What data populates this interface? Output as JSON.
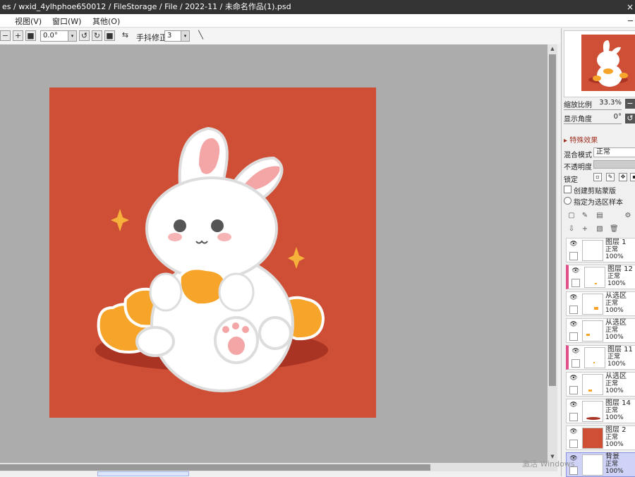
{
  "titlebar": {
    "title": "es / wxid_4ylhphoe650012 / FileStorage / File / 2022-11 / 未命名作品(1).psd",
    "close_glyph": "×"
  },
  "menubar": {
    "items": [
      "视图(V)",
      "窗口(W)",
      "其他(O)"
    ]
  },
  "toolbar": {
    "minus_glyph": "−",
    "plus_glyph": "+",
    "square_glyph": "■",
    "rotation_value": "0.0°",
    "rotate_ccw_glyph": "↺",
    "rotate_cw_glyph": "↻",
    "reset_glyph": "■",
    "flip_glyph": "⇆",
    "stabilizer_label": "手抖修正",
    "stabilizer_value": "3",
    "pen_glyph": "╲",
    "dropdown_glyph": "▾"
  },
  "navigator": {
    "zoom_label": "缩放比例",
    "zoom_value": "33.3%",
    "angle_label": "显示角度",
    "angle_value": "0°",
    "zoom_btn_glyph": "−",
    "angle_btn_glyph": "↺"
  },
  "properties": {
    "fx_label": "▸ 特殊效果",
    "blend_label": "混合模式",
    "blend_value": "正常",
    "opacity_label": "不透明度",
    "lock_label": "锁定",
    "clip_label": "创建剪贴蒙版",
    "select_source_label": "指定为选区样本"
  },
  "layers": [
    {
      "name": "图层 1",
      "mode": "正常",
      "opacity": "100%",
      "marked": false,
      "selected": false
    },
    {
      "name": "图层 12",
      "mode": "正常",
      "opacity": "100%",
      "marked": true,
      "selected": false
    },
    {
      "name": "从选区",
      "mode": "正常",
      "opacity": "100%",
      "marked": false,
      "selected": false
    },
    {
      "name": "从选区",
      "mode": "正常",
      "opacity": "100%",
      "marked": false,
      "selected": false
    },
    {
      "name": "图层 11",
      "mode": "正常",
      "opacity": "100%",
      "marked": true,
      "selected": false
    },
    {
      "name": "从选区",
      "mode": "正常",
      "opacity": "100%",
      "marked": false,
      "selected": false
    },
    {
      "name": "图层 14",
      "mode": "正常",
      "opacity": "100%",
      "marked": false,
      "selected": false
    },
    {
      "name": "图层 2",
      "mode": "正常",
      "opacity": "100%",
      "marked": false,
      "selected": false
    },
    {
      "name": "背景",
      "mode": "正常",
      "opacity": "100%",
      "marked": false,
      "selected": true
    }
  ],
  "watermark": "激活 Windows",
  "colors": {
    "canvas_bg": "#acacac",
    "artwork_bg": "#cf4f36",
    "gold": "#f7a52a",
    "layer_mark": "#e0508a",
    "selected_layer": "#cfd3f7"
  }
}
